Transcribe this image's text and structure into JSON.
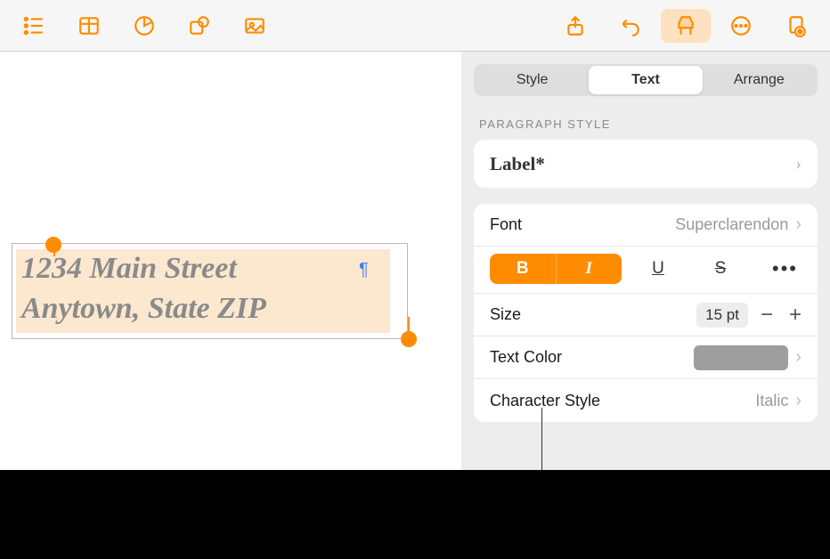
{
  "toolbar": {
    "accent": "#ff8c00"
  },
  "canvas": {
    "address_line1": "1234 Main Street",
    "address_line2": "Anytown, State ZIP",
    "paragraph_mark": "¶"
  },
  "inspector": {
    "tabs": {
      "style": "Style",
      "text": "Text",
      "arrange": "Arrange"
    },
    "paragraph_section_label": "PARAGRAPH STYLE",
    "paragraph_style": "Label*",
    "font_label": "Font",
    "font_value": "Superclarendon",
    "bold": "B",
    "italic": "I",
    "underline": "U",
    "strikethrough": "S",
    "more": "•••",
    "size_label": "Size",
    "size_value": "15 pt",
    "minus": "−",
    "plus": "+",
    "text_color_label": "Text Color",
    "text_color_value": "#9e9e9e",
    "char_style_label": "Character Style",
    "char_style_value": "Italic"
  }
}
